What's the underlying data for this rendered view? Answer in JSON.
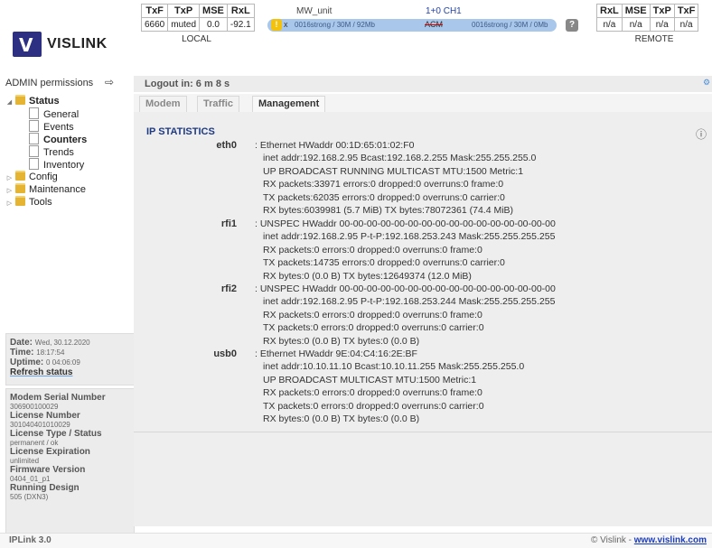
{
  "brand": {
    "logo_mark": "V",
    "logo_text": "VISLINK"
  },
  "local": {
    "headers": [
      "TxF",
      "TxP",
      "MSE",
      "RxL"
    ],
    "values": [
      "6660",
      "muted",
      "0.0",
      "-92.1"
    ],
    "label": "LOCAL"
  },
  "remote": {
    "headers": [
      "RxL",
      "MSE",
      "TxP",
      "TxF"
    ],
    "values": [
      "n/a",
      "n/a",
      "n/a",
      "n/a"
    ],
    "label": "REMOTE"
  },
  "unit": {
    "name": "MW_unit",
    "channel": "1+0 CH1",
    "warn_badge": "!",
    "warn_count": "x",
    "link_left": "0016strong / 30M / 92Mb",
    "acm": "ACM",
    "link_right": "0016strong / 30M / 0Mb",
    "help": "?"
  },
  "nav": {
    "admin": "ADMIN permissions",
    "status": "Status",
    "status_items": [
      "General",
      "Events",
      "Counters",
      "Trends",
      "Inventory"
    ],
    "config": "Config",
    "maintenance": "Maintenance",
    "tools": "Tools"
  },
  "side_date": {
    "date_label": "Date:",
    "date": "Wed, 30.12.2020",
    "time_label": "Time:",
    "time": "18:17:54",
    "uptime_label": "Uptime:",
    "uptime": "0 04:06:09",
    "refresh": "Refresh status"
  },
  "side_info": [
    {
      "label": "Modem Serial Number",
      "value": "306900100029"
    },
    {
      "label": "License Number",
      "value": "301040401010029"
    },
    {
      "label": "License Type / Status",
      "value": "permanent / ok"
    },
    {
      "label": "License Expiration",
      "value": "unlimited"
    },
    {
      "label": "Firmware Version",
      "value": "0404_01_p1"
    },
    {
      "label": "Running Design",
      "value": "505 (DXN3)"
    }
  ],
  "logout": "Logout in: 6 m 8 s",
  "tabs": [
    "Modem",
    "Traffic",
    "Management"
  ],
  "ip_title": "IP STATISTICS",
  "ifaces": [
    {
      "name": "eth0",
      "lines": [
        ": Ethernet  HWaddr 00:1D:65:01:02:F0",
        "inet addr:192.168.2.95  Bcast:192.168.2.255  Mask:255.255.255.0",
        "UP BROADCAST RUNNING MULTICAST  MTU:1500  Metric:1",
        "RX packets:33971 errors:0 dropped:0 overruns:0 frame:0",
        "TX packets:62035 errors:0 dropped:0 overruns:0 carrier:0",
        "RX bytes:6039981 (5.7 MiB)  TX bytes:78072361 (74.4 MiB)"
      ]
    },
    {
      "name": "rfi1",
      "lines": [
        ": UNSPEC  HWaddr 00-00-00-00-00-00-00-00-00-00-00-00-00-00-00-00",
        "inet addr:192.168.2.95  P-t-P:192.168.253.243  Mask:255.255.255.255",
        "RX packets:0 errors:0 dropped:0 overruns:0 frame:0",
        "TX packets:14735 errors:0 dropped:0 overruns:0 carrier:0",
        "RX bytes:0 (0.0 B)  TX bytes:12649374 (12.0 MiB)"
      ]
    },
    {
      "name": "rfi2",
      "lines": [
        ": UNSPEC  HWaddr 00-00-00-00-00-00-00-00-00-00-00-00-00-00-00-00",
        "inet addr:192.168.2.95  P-t-P:192.168.253.244  Mask:255.255.255.255",
        "RX packets:0 errors:0 dropped:0 overruns:0 frame:0",
        "TX packets:0 errors:0 dropped:0 overruns:0 carrier:0",
        "RX bytes:0 (0.0 B)  TX bytes:0 (0.0 B)"
      ]
    },
    {
      "name": "usb0",
      "lines": [
        ": Ethernet  HWaddr 9E:04:C4:16:2E:BF",
        "inet addr:10.10.11.10  Bcast:10.10.11.255  Mask:255.255.255.0",
        "UP BROADCAST MULTICAST  MTU:1500  Metric:1",
        "RX packets:0 errors:0 dropped:0 overruns:0 frame:0",
        "TX packets:0 errors:0 dropped:0 overruns:0 carrier:0",
        "RX bytes:0 (0.0 B)  TX bytes:0 (0.0 B)"
      ]
    }
  ],
  "footer": {
    "left": "IPLink 3.0",
    "copyright": "© Vislink - ",
    "link": "www.vislink.com"
  }
}
